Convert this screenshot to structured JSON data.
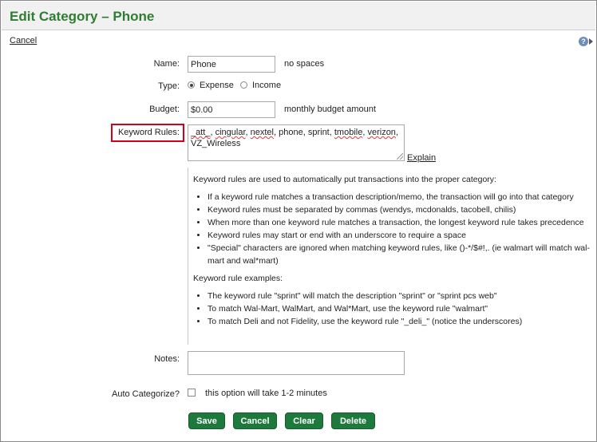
{
  "window": {
    "title": "Edit Category – Phone"
  },
  "top": {
    "cancel_label": "Cancel",
    "help_icon": "question-circle-icon"
  },
  "form": {
    "name": {
      "label": "Name:",
      "value": "Phone",
      "hint": "no spaces"
    },
    "type": {
      "label": "Type:",
      "options": [
        "Expense",
        "Income"
      ],
      "selected": "Expense"
    },
    "budget": {
      "label": "Budget:",
      "value": "$0.00",
      "hint": "monthly budget amount"
    },
    "keyword_rules": {
      "label": "Keyword Rules:",
      "words": [
        "_att_",
        "cingular",
        "nextel",
        "phone",
        "sprint",
        "tmobile",
        "verizon",
        "VZ_Wireless"
      ],
      "explain_label": "Explain"
    },
    "notes": {
      "label": "Notes:",
      "value": ""
    },
    "auto_categorize": {
      "label": "Auto Categorize?",
      "checked": false,
      "hint": "this option will take 1-2 minutes"
    }
  },
  "info": {
    "intro": "Keyword rules are used to automatically put transactions into the proper category:",
    "rules": [
      "If a keyword rule matches a transaction description/memo, the transaction will go into that category",
      "Keyword rules must be separated by commas (wendys, mcdonalds, tacobell, chilis)",
      "When more than one keyword rule matches a transaction, the longest keyword rule takes precedence",
      "Keyword rules may start or end with an underscore to require a space",
      "\"Special\" characters are ignored when matching keyword rules, like ()-*/$#!,. (ie walmart will match wal-mart and wal*mart)"
    ],
    "examples_heading": "Keyword rule examples:",
    "examples": [
      "The keyword rule \"sprint\" will match the description \"sprint\" or \"sprint pcs web\"",
      "To match Wal-Mart, WalMart, and Wal*Mart, use the keyword rule \"walmart\"",
      "To match Deli and not Fidelity, use the keyword rule \"_deli_\" (notice the underscores)"
    ]
  },
  "buttons": {
    "save": "Save",
    "cancel": "Cancel",
    "clear": "Clear",
    "delete": "Delete"
  },
  "colors": {
    "accent": "#2e7d32",
    "button": "#1e7a3c",
    "highlight": "#d0021b"
  }
}
